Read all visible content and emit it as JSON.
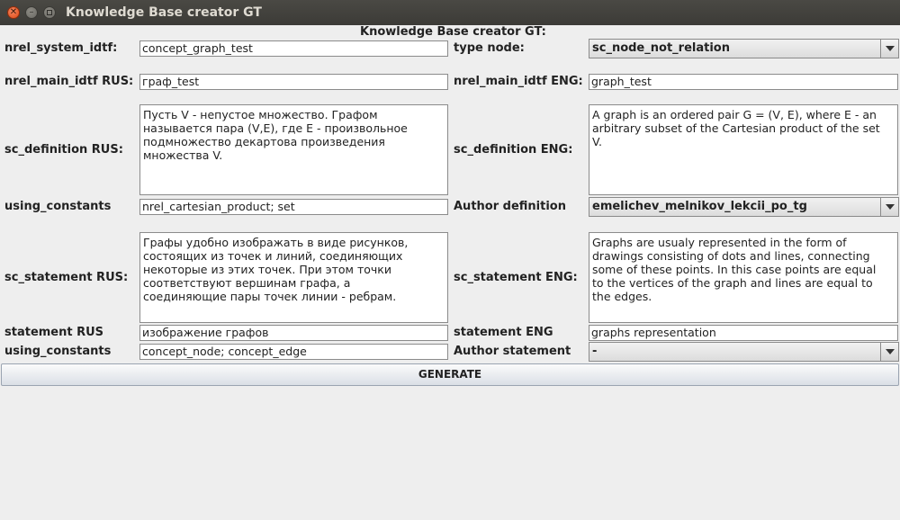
{
  "window": {
    "title": "Knowledge Base creator GT"
  },
  "form": {
    "heading": "Knowledge Base creator GT:",
    "system_idtf": {
      "label": "nrel_system_idtf:",
      "value": "concept_graph_test"
    },
    "type_node": {
      "label": "type node:",
      "value": "sc_node_not_relation"
    },
    "main_idtf_rus": {
      "label": "nrel_main_idtf RUS:",
      "value": "граф_test"
    },
    "main_idtf_eng": {
      "label": "nrel_main_idtf ENG:",
      "value": "graph_test"
    },
    "definition_rus": {
      "label": "sc_definition RUS:",
      "value": "Пусть V - непустое множество. Графом\nназывается пара (V,E), где E - произвольное\nподмножество декартова произведения\nмножества V."
    },
    "definition_eng": {
      "label": "sc_definition ENG:",
      "value": "A graph is an ordered pair G = (V, E), where E - an\narbitrary subset of the Cartesian product of the set\nV."
    },
    "using_constants_1": {
      "label": "using_constants",
      "value": "nrel_cartesian_product; set"
    },
    "author_definition": {
      "label": "Author definition",
      "value": "emelichev_melnikov_lekcii_po_tg"
    },
    "statement_rus": {
      "label": "sc_statement RUS:",
      "value": "Графы удобно изображать в виде рисунков,\nсостоящих из точек и линий, соединяющих\nнекоторые из этих точек. При этом точки\nсоответствуют вершинам графа, а\nсоединяющие пары точек линии - ребрам."
    },
    "statement_eng": {
      "label": "sc_statement ENG:",
      "value": "Graphs are usualy represented in the form of\ndrawings consisting of dots and lines, connecting\nsome of these points. In this case points are equal\nto the vertices of the graph and lines are equal to\nthe edges."
    },
    "statement_title_rus": {
      "label": "statement RUS",
      "value": "изображение графов"
    },
    "statement_title_eng": {
      "label": "statement ENG",
      "value": "graphs representation"
    },
    "using_constants_2": {
      "label": "using_constants",
      "value": "concept_node; concept_edge"
    },
    "author_statement": {
      "label": "Author statement",
      "value": "-"
    },
    "generate_label": "GENERATE"
  }
}
